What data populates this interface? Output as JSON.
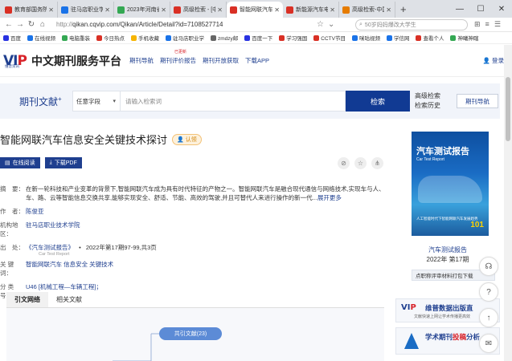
{
  "browser": {
    "tabs": [
      {
        "title": "教育部国务院",
        "color": "#d93025",
        "active": false
      },
      {
        "title": "驻马店职业学",
        "color": "#1a73e8",
        "active": false
      },
      {
        "title": "2023年河南省",
        "color": "#34a853",
        "active": false
      },
      {
        "title": "高级检索 - [中",
        "color": "#d93025",
        "active": false
      },
      {
        "title": "智能网联汽车",
        "color": "#d93025",
        "active": true
      },
      {
        "title": "新能源汽车电",
        "color": "#d93025",
        "active": false
      },
      {
        "title": "高级检索-中国",
        "color": "#e67c00",
        "active": false
      }
    ],
    "new_tab": "+",
    "url_protocol": "http://",
    "url_path": "qikan.cqvip.com/Qikan/Article/Detail?id=7108527714",
    "search_placeholder": "50岁妈妈爆改大学生",
    "bookmarks": [
      {
        "label": "百度",
        "color": "#2932e1"
      },
      {
        "label": "在线视频",
        "color": "#1a73e8"
      },
      {
        "label": "电脑重装",
        "color": "#34a853"
      },
      {
        "label": "今日热点",
        "color": "#d93025"
      },
      {
        "label": "手机收藏",
        "color": "#f6b400"
      },
      {
        "label": "驻马店职业学",
        "color": "#1a73e8"
      },
      {
        "label": "zmdzy邮",
        "color": "#666666"
      },
      {
        "label": "百度一下",
        "color": "#2932e1"
      },
      {
        "label": "学习强国",
        "color": "#d93025"
      },
      {
        "label": "CCTV节目",
        "color": "#d93025"
      },
      {
        "label": "咪咕视频",
        "color": "#1a73e8"
      },
      {
        "label": "学信网",
        "color": "#1a73e8"
      },
      {
        "label": "查看个人",
        "color": "#d93025"
      },
      {
        "label": "神曦神瞎",
        "color": "#34a853"
      }
    ]
  },
  "site": {
    "logo": {
      "v": "V",
      "i": "I",
      "p": "P",
      "sub": "维普资讯"
    },
    "title": "中文期刊服务平台",
    "nav": [
      {
        "label": "期刊导航",
        "badge": ""
      },
      {
        "label": "期刊评价报告",
        "badge": "已更新"
      },
      {
        "label": "期刊开放获取",
        "badge": ""
      },
      {
        "label": "下载APP",
        "badge": ""
      }
    ],
    "login": "登录"
  },
  "search": {
    "band_title": "期刊文献",
    "field_label": "任意字段",
    "placeholder": "请输入检索词",
    "button": "检索",
    "advanced": "高级检索",
    "history": "检索历史",
    "journal_nav": "期刊导航"
  },
  "article": {
    "title": "智能网联汽车信息安全关键技术探讨",
    "claim": "认领",
    "read_online": "在线阅读",
    "download": "下载PDF",
    "abstract_key": "摘　要：",
    "abstract_line1": "在新一轮科技和产业变革的背景下,智能网联汽车成为具有时代特征的产物之一。智能网联汽车是融合现代通信与网络技术,实现车与人、",
    "abstract_line2": "车、路、云等智能信息交换共享,能够实现安全、舒适、节能、高效的驾驶,并且可替代人来进行操作的新一代...",
    "expand": "展开更多",
    "author_key": "作　者：",
    "author": "陈俊亚",
    "org_key": "机构地区：",
    "org": "驻马店职业技术学院",
    "source_key": "出　处：",
    "source_journal": "《汽车测试报告》",
    "source_detail": "2022年第17期97-99,共3页",
    "source_en": "Car Test Report",
    "keywords_key": "关 键 词：",
    "keywords": "智能网联汽车 信息安全 关键技术",
    "class_key": "分 类 号：",
    "class_value": "U46 [机械工程—车辆工程]；",
    "tab_citation": "引文网络",
    "tab_related": "相关文献",
    "cite_node": "共引文献(23)"
  },
  "side": {
    "cover_title": "汽车测试报告",
    "cover_en": "Car Test Report",
    "cover_foot": "人工智能时代下智能网联汽车发展趋势",
    "cover_number": "101",
    "journal_name": "汽车测试报告",
    "issue": "2022年 第17期",
    "pack": "点职称评审材料打包下载",
    "ad1_title": "维普数据出版直",
    "ad1_sub": "文献快速上网让学术传播更高效",
    "ad2_title_a": "学术期刊",
    "ad2_title_b": "投稿",
    "ad2_title_c": "分析"
  },
  "colors": {
    "brand": "#1f3f8f",
    "accent": "#d8232a",
    "search_button": "#113a93"
  }
}
